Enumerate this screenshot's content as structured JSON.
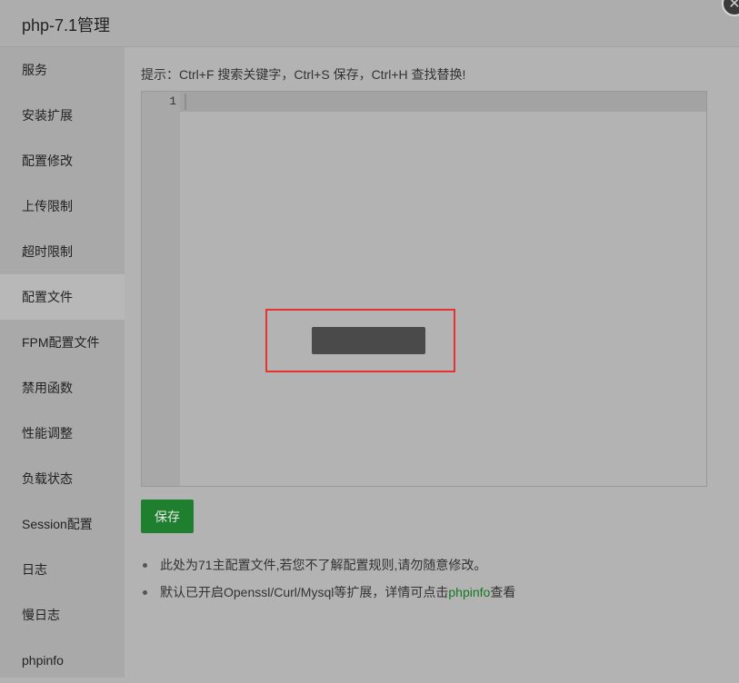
{
  "title": "php-7.1管理",
  "close_icon": "close-icon",
  "sidebar": {
    "items": [
      {
        "label": "服务"
      },
      {
        "label": "安装扩展"
      },
      {
        "label": "配置修改"
      },
      {
        "label": "上传限制"
      },
      {
        "label": "超时限制"
      },
      {
        "label": "配置文件",
        "active": true
      },
      {
        "label": "FPM配置文件"
      },
      {
        "label": "禁用函数"
      },
      {
        "label": "性能调整"
      },
      {
        "label": "负载状态"
      },
      {
        "label": "Session配置"
      },
      {
        "label": "日志"
      },
      {
        "label": "慢日志"
      },
      {
        "label": "phpinfo"
      }
    ]
  },
  "main": {
    "hint": "提示：Ctrl+F 搜索关键字，Ctrl+S 保存，Ctrl+H 查找替换!",
    "editor": {
      "line_number": "1",
      "content": ""
    },
    "save_label": "保存",
    "notes": {
      "line1": "此处为71主配置文件,若您不了解配置规则,请勿随意修改。",
      "line2_prefix": "默认已开启Openssl/Curl/Mysql等扩展，详情可点击",
      "line2_link": "phpinfo",
      "line2_suffix": "查看"
    }
  },
  "colors": {
    "accent_green": "#1e7f2e",
    "link_green": "#157a22",
    "highlight_red": "#e53333"
  }
}
